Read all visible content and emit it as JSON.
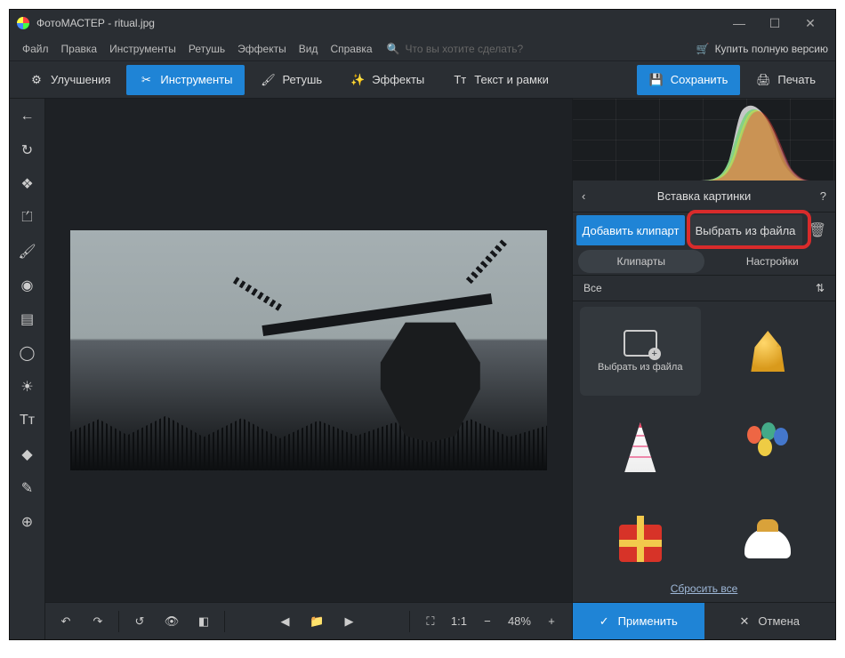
{
  "title": "ФотоМАСТЕР - ritual.jpg",
  "menu": {
    "items": [
      "Файл",
      "Правка",
      "Инструменты",
      "Ретушь",
      "Эффекты",
      "Вид",
      "Справка"
    ],
    "search_placeholder": "Что вы хотите сделать?",
    "buy": "Купить полную версию"
  },
  "toolbar": {
    "enhance": "Улучшения",
    "tools": "Инструменты",
    "retouch": "Ретушь",
    "effects": "Эффекты",
    "text": "Текст и рамки",
    "save": "Сохранить",
    "print": "Печать"
  },
  "bottom": {
    "zoom_label": "1:1",
    "zoom_pct": "48%"
  },
  "panel": {
    "title": "Вставка картинки",
    "add_clipart": "Добавить клипарт",
    "pick_file": "Выбрать из файла",
    "tab_cliparts": "Клипарты",
    "tab_settings": "Настройки",
    "category": "Все",
    "pick_file_cell": "Выбрать из файла",
    "reset": "Сбросить все",
    "apply": "Применить",
    "cancel": "Отмена"
  }
}
